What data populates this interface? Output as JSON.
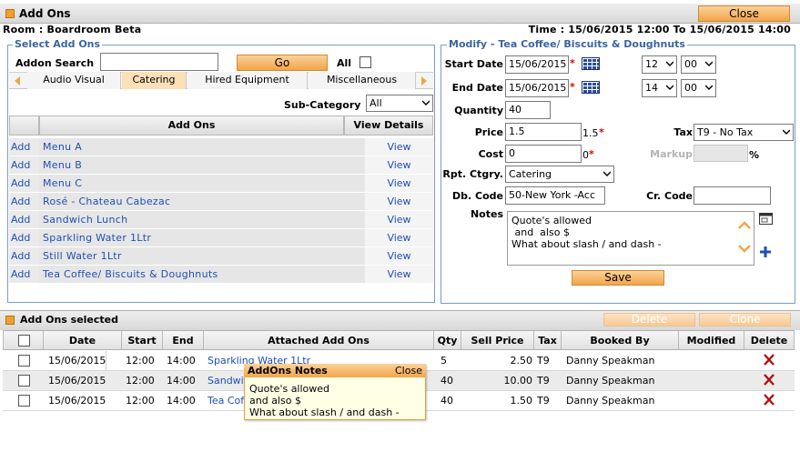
{
  "title_bar": {
    "title": "Add Ons",
    "close_label": "Close"
  },
  "room_line": {
    "room": "Room : Boardroom Beta",
    "time": "Time : 15/06/2015 12:00 To 15/06/2015 14:00"
  },
  "select_panel": {
    "legend": "Select Add Ons",
    "search_label": "Addon Search",
    "search_value": "",
    "go_label": "Go",
    "all_label": "All",
    "tabs": [
      "Audio Visual",
      "Catering",
      "Hired Equipment",
      "Miscellaneous"
    ],
    "active_tab": "Catering",
    "subcategory_label": "Sub-Category",
    "subcategory_value": "All",
    "grid_headers": {
      "add_ons": "Add Ons",
      "view_details": "View Details"
    },
    "rows": [
      {
        "add": "Add",
        "name": "Menu A",
        "view": "View"
      },
      {
        "add": "Add",
        "name": "Menu B",
        "view": "View"
      },
      {
        "add": "Add",
        "name": "Menu C",
        "view": "View"
      },
      {
        "add": "Add",
        "name": "Rosé - Chateau Cabezac",
        "view": "View"
      },
      {
        "add": "Add",
        "name": "Sandwich Lunch",
        "view": "View"
      },
      {
        "add": "Add",
        "name": "Sparkling Water 1Ltr",
        "view": "View"
      },
      {
        "add": "Add",
        "name": "Still Water 1Ltr",
        "view": "View"
      },
      {
        "add": "Add",
        "name": "Tea Coffee/ Biscuits & Doughnuts",
        "view": "View"
      }
    ]
  },
  "modify_panel": {
    "legend": "Modify - Tea Coffee/ Biscuits & Doughnuts",
    "start_date_label": "Start Date",
    "start_date": "15/06/2015",
    "start_hour": "12",
    "start_min": "00",
    "end_date_label": "End Date",
    "end_date": "15/06/2015",
    "end_hour": "14",
    "end_min": "00",
    "quantity_label": "Quantity",
    "quantity": "40",
    "price_label": "Price",
    "price": "1.5",
    "price_hint": "1.5",
    "tax_label": "Tax",
    "tax_value": "T9 - No Tax",
    "cost_label": "Cost",
    "cost": "0",
    "cost_hint": "0",
    "markup_label": "Markup",
    "markup_unit": "%",
    "rpt_label": "Rpt. Ctgry.",
    "rpt_value": "Catering",
    "db_label": "Db. Code",
    "db_value": "50-New York -Acc",
    "cr_label": "Cr. Code",
    "cr_value": "",
    "notes_label": "Notes",
    "notes_lines": [
      "Quote's allowed",
      " and  also $",
      "What about slash / and dash -"
    ],
    "save_label": "Save",
    "required_mark": "*"
  },
  "selected_panel": {
    "title": "Add Ons selected",
    "delete_label": "Delete",
    "clone_label": "Clone",
    "headers": [
      "Date",
      "Start",
      "End",
      "Attached Add Ons",
      "Qty",
      "Sell Price",
      "Tax",
      "Booked By",
      "Modified",
      "Delete"
    ],
    "rows": [
      {
        "date": "15/06/2015",
        "start": "12:00",
        "end": "14:00",
        "addon": "Sparkling Water 1Ltr",
        "qty": "5",
        "sell": "2.50",
        "tax": "T9",
        "booked_by": "Danny Speakman",
        "modified": ""
      },
      {
        "date": "15/06/2015",
        "start": "12:00",
        "end": "14:00",
        "addon": "Sandwich Lunch",
        "qty": "40",
        "sell": "10.00",
        "tax": "T9",
        "booked_by": "Danny Speakman",
        "modified": ""
      },
      {
        "date": "15/06/2015",
        "start": "12:00",
        "end": "14:00",
        "addon": "Tea Coffee/ Biscuits & Doughnuts",
        "qty": "40",
        "sell": "1.50",
        "tax": "T9",
        "booked_by": "Danny Speakman",
        "modified": ""
      }
    ]
  },
  "notes_popup": {
    "title": "AddOns Notes",
    "close_label": "Close",
    "lines": [
      "Quote's allowed",
      "and also $",
      "What about slash / and dash -"
    ]
  },
  "colors": {
    "accent_orange": "#f3a44a",
    "link_blue": "#1e4fb4",
    "panel_border": "#7a9cc4",
    "delete_red": "#b01010"
  }
}
